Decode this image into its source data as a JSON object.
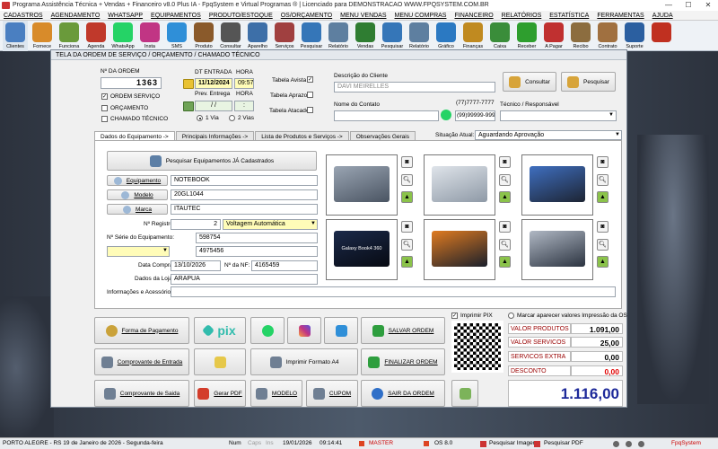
{
  "window": {
    "title": "Programa Assistência Técnica + Vendas + Financeiro v8.0 Plus IA - FpqSystem e Virtual Programas ® | Licenciado para  DEMONSTRACAO WWW.FPQSYSTEM.COM.BR"
  },
  "menu": [
    "CADASTROS",
    "AGENDAMENTO",
    "WHATSAPP",
    "EQUIPAMENTOS",
    "PRODUTO/ESTOQUE",
    "OS/ORÇAMENTO",
    "MENU VENDAS",
    "MENU COMPRAS",
    "FINANCEIRO",
    "RELATÓRIOS",
    "ESTATÍSTICA",
    "FERRAMENTAS",
    "AJUDA"
  ],
  "toolbar": [
    {
      "label": "Clientes",
      "icon": "clients-icon",
      "color": "#4a7fc1"
    },
    {
      "label": "Fornece",
      "icon": "suppliers-icon",
      "color": "#d88b2a"
    },
    {
      "label": "Funciona",
      "icon": "employees-icon",
      "color": "#6a9a3b"
    },
    {
      "label": "Agenda",
      "icon": "calendar-icon",
      "color": "#c0392b"
    },
    {
      "label": "WhatsApp",
      "icon": "whatsapp-icon",
      "color": "#25d366"
    },
    {
      "label": "Insta",
      "icon": "instagram-icon",
      "color": "#c13584"
    },
    {
      "label": "SMS",
      "icon": "sms-icon",
      "color": "#2f8fd8"
    },
    {
      "label": "Produto",
      "icon": "product-icon",
      "color": "#8a5a2b"
    },
    {
      "label": "Consultar",
      "icon": "barcode-icon",
      "color": "#555555"
    },
    {
      "label": "Aparelho",
      "icon": "device-icon",
      "color": "#3d6fa8"
    },
    {
      "label": "Serviços",
      "icon": "tools-icon",
      "color": "#a04040"
    },
    {
      "label": "Pesquisar",
      "icon": "search-icon",
      "color": "#3576b8"
    },
    {
      "label": "Relatório",
      "icon": "report-icon",
      "color": "#5e7fa0"
    },
    {
      "label": "Vendas",
      "icon": "cart-icon",
      "color": "#2f7d32"
    },
    {
      "label": "Pesquisar",
      "icon": "search-icon",
      "color": "#3576b8"
    },
    {
      "label": "Relatório",
      "icon": "report-icon",
      "color": "#5e7fa0"
    },
    {
      "label": "Gráfico",
      "icon": "chart-icon",
      "color": "#2b79c2"
    },
    {
      "label": "Finanças",
      "icon": "finance-icon",
      "color": "#c08a20"
    },
    {
      "label": "Caixa",
      "icon": "cashier-icon",
      "color": "#3a8d3a"
    },
    {
      "label": "Receber",
      "icon": "receive-icon",
      "color": "#2e9e2e"
    },
    {
      "label": "A Pagar",
      "icon": "pay-icon",
      "color": "#c03030"
    },
    {
      "label": "Recibo",
      "icon": "receipt-icon",
      "color": "#8c6d3f"
    },
    {
      "label": "Contrato",
      "icon": "contract-icon",
      "color": "#a07040"
    },
    {
      "label": "Suporte",
      "icon": "support-icon",
      "color": "#2b5fa0"
    },
    {
      "label": "",
      "icon": "exit-icon",
      "color": "#c03020"
    }
  ],
  "dialog": {
    "title": "TELA DA ORDEM DE SERVIÇO / ORÇAMENTO / CHAMADO TÉCNICO",
    "order_label": "Nº DA ORDEM",
    "order_number": "1363",
    "doc_types": [
      {
        "label": "ORDEM SERVIÇO",
        "checked": "✓"
      },
      {
        "label": "ORÇAMENTO",
        "checked": ""
      },
      {
        "label": "CHAMADO TÉCNICO",
        "checked": ""
      }
    ],
    "dt_entrada_label": "DT ENTRADA",
    "dt_entrada": "11/12/2024",
    "hora_label": "HORA",
    "hora": "09:57",
    "prev_entrega_label": "Prev. Entrega",
    "prev_entrega": "/ /",
    "hora2_label": "HORA",
    "hora2": ":",
    "via1": "1 Via",
    "via2": "2 Vias",
    "tabela_avista": "Tabela Avista",
    "tabela_avista_checked": "✓",
    "tabela_aprazo": "Tabela Aprazo",
    "tabela_atacado": "Tabela Atacado",
    "cliente_label": "Descrição do Cliente",
    "cliente": "DAVI MEIRELLES",
    "consultar": "Consultar",
    "pesquisar": "Pesquisar",
    "contato_label": "Nome do Contato",
    "contato": "",
    "phone1": "(77)7777-7777",
    "phone2": "(99)99999-9999",
    "tecnico_label": "Técnico / Responsável",
    "tecnico": ""
  },
  "tabs": [
    "Dados do Equipamento ->",
    "Principais Informações ->",
    "Lista de Produtos e Serviços ->",
    "Observações Gerais"
  ],
  "situacao_label": "Situação Atual:",
  "situacao": "Aguardando Aprovação",
  "equipment": {
    "search_btn": "Pesquisar Equipamentos JÁ Cadastrados",
    "equipamento_btn": "Equipamento",
    "equipamento": "NOTEBOOK",
    "modelo_btn": "Modelo",
    "modelo": "20GL1044",
    "marca_btn": "Marca",
    "marca": "ITAUTEC",
    "registro_label": "Nº Registro:",
    "registro": "2",
    "voltagem": "Voltagem Automática",
    "serie_label": "Nº Série do Equipamento:",
    "serie": "598754",
    "extra_value": "4975456",
    "compra_label": "Data Compra:",
    "compra": "13/10/2026",
    "nf_label": "Nº da NF:",
    "nf": "4165459",
    "loja_label": "Dados da Loja:",
    "loja": "ARAPUA",
    "info_label": "Informações e Acessórios:",
    "info": "",
    "photo_caption": "Galaxy Book4 360"
  },
  "bottom": {
    "forma_pagamento": "Forma de Pagamento",
    "pix": "pix",
    "salvar": "SALVAR ORDEM",
    "comprovante_entrada": "Comprovante de Entrada",
    "imprimir_a4": "Imprimir Formato A4",
    "finalizar": "FINALIZAR ORDEM",
    "comprovante_saida": "Comprovante de Saida",
    "gerar_pdf": "Gerar PDF",
    "modelo": "MODELO",
    "cupom": "CUPOM",
    "sair": "SAIR DA ORDEM",
    "imprimir_pix": "Imprimir PIX",
    "imprimir_pix_checked": "✓",
    "marcar_valores": "Marcar aparecer valores Impressão da OS"
  },
  "totals": [
    {
      "label": "VALOR PRODUTOS",
      "value": "1.091,00",
      "color": "#000000"
    },
    {
      "label": "VALOR SERVICOS",
      "value": "25,00",
      "color": "#000000"
    },
    {
      "label": "SERVICOS EXTRA",
      "value": "0,00",
      "color": "#000000"
    },
    {
      "label": "DESCONTO",
      "value": "0,00",
      "color": "#e00000"
    }
  ],
  "total_final": "1.116,00",
  "status": {
    "city": "PORTO ALEGRE - RS 19 de Janeiro de 2026 - Segunda-feira",
    "num": "Num",
    "caps": "Caps",
    "ins": "Ins",
    "date": "19/01/2026",
    "time": "09:14:41",
    "master": "MASTER",
    "os": "OS 8.0",
    "pesquisar_imagens": "Pesquisar Imagens",
    "pesquisar_pdf": "Pesquisar PDF",
    "brand": "FpqSystem"
  }
}
